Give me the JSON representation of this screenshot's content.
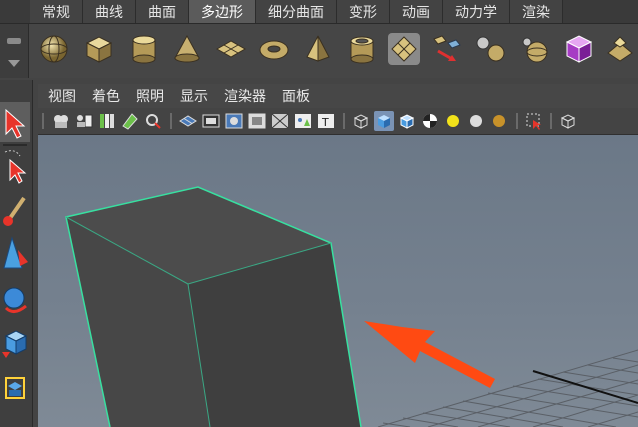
{
  "shelf_tabs": [
    {
      "label": "常规",
      "active": false
    },
    {
      "label": "曲线",
      "active": false
    },
    {
      "label": "曲面",
      "active": false
    },
    {
      "label": "多边形",
      "active": true
    },
    {
      "label": "细分曲面",
      "active": false
    },
    {
      "label": "变形",
      "active": false
    },
    {
      "label": "动画",
      "active": false
    },
    {
      "label": "动力学",
      "active": false
    },
    {
      "label": "渲染",
      "active": false
    }
  ],
  "shelf_icons": [
    "polygon-sphere-icon",
    "polygon-cube-icon",
    "polygon-cylinder-icon",
    "polygon-cone-icon",
    "polygon-plane-icon",
    "polygon-torus-icon",
    "polygon-pyramid-icon",
    "polygon-pipe-icon",
    "polygon-soccerball-icon",
    "combine-icon",
    "separate-icon",
    "smooth-icon",
    "purple-cube-icon",
    "extrude-icon"
  ],
  "panel_menus": [
    "视图",
    "着色",
    "照明",
    "显示",
    "渲染器",
    "面板"
  ],
  "toolbox": [
    "select-tool-icon",
    "lasso-tool-icon",
    "paint-tool-icon",
    "move-tool-icon",
    "rotate-tool-icon",
    "scale-tool-icon",
    "manipulator-icon"
  ],
  "colors": {
    "selection_highlight": "#38e0a0",
    "arrow": "#ff4a12",
    "viewport_bg": "#737f8c",
    "active_tab": "#5b5b5b"
  }
}
